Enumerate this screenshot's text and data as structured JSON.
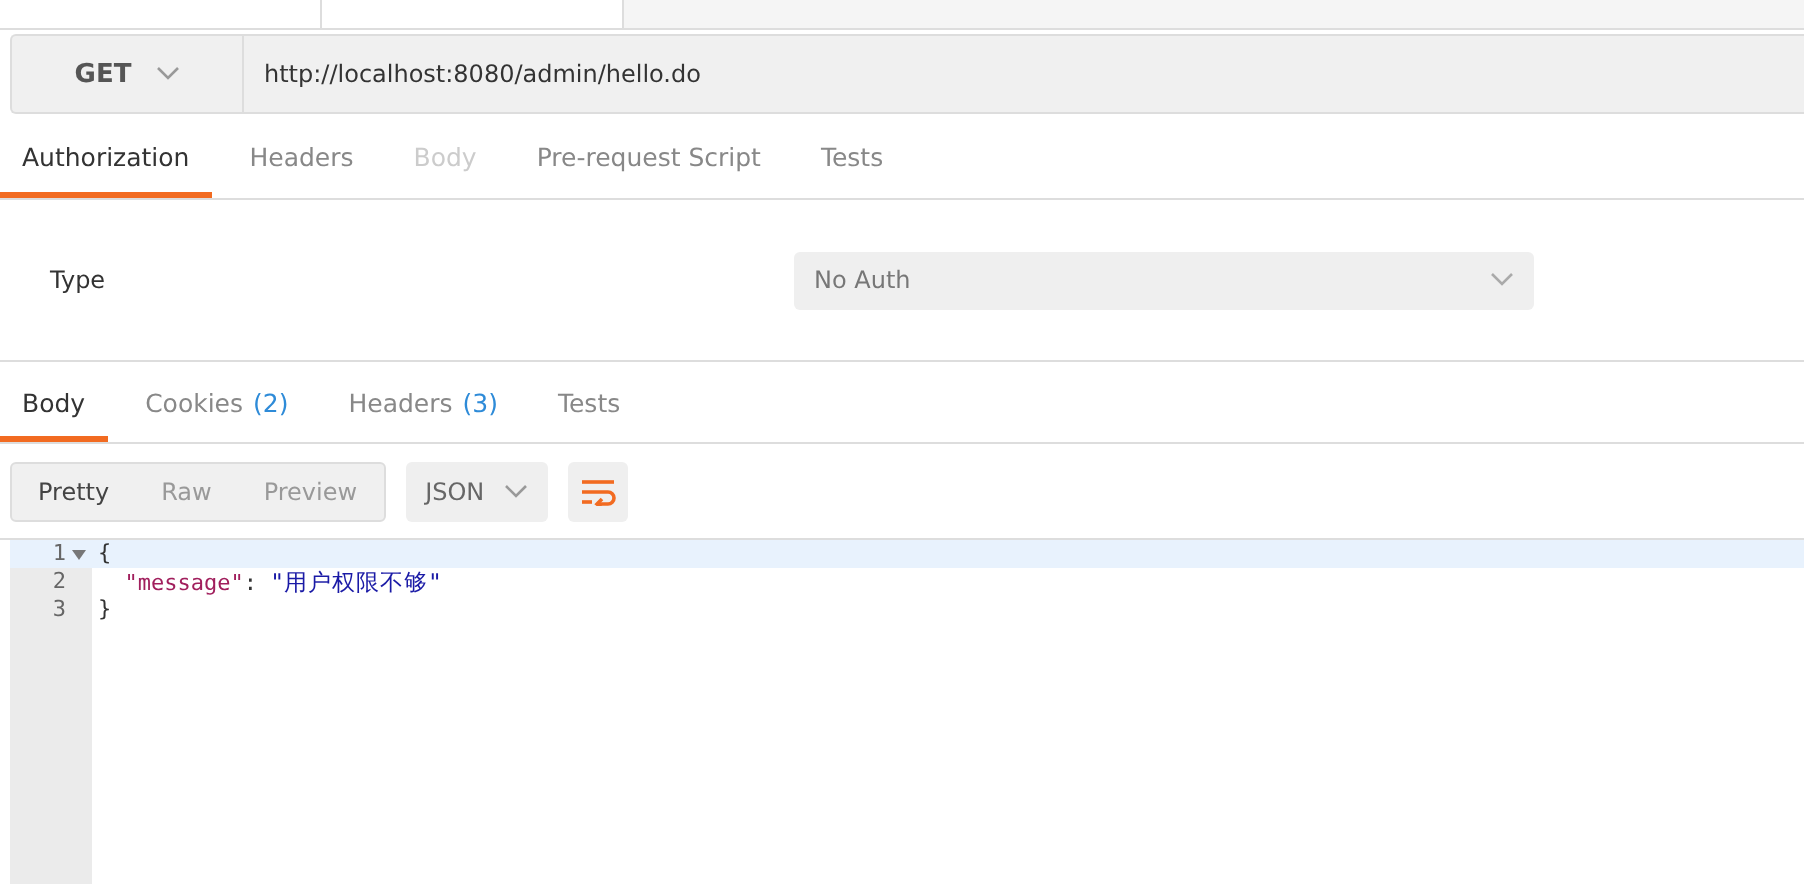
{
  "request": {
    "method": "GET",
    "url": "http://localhost:8080/admin/hello.do"
  },
  "request_tabs": [
    {
      "label": "Authorization",
      "selected": true,
      "disabled": false
    },
    {
      "label": "Headers",
      "selected": false,
      "disabled": false
    },
    {
      "label": "Body",
      "selected": false,
      "disabled": true
    },
    {
      "label": "Pre-request Script",
      "selected": false,
      "disabled": false
    },
    {
      "label": "Tests",
      "selected": false,
      "disabled": false
    }
  ],
  "authorization": {
    "type_label": "Type",
    "type_value": "No Auth"
  },
  "response_tabs": [
    {
      "label": "Body",
      "selected": true
    },
    {
      "label": "Cookies",
      "count": "(2)",
      "selected": false
    },
    {
      "label": "Headers",
      "count": "(3)",
      "selected": false
    },
    {
      "label": "Tests",
      "selected": false
    }
  ],
  "view_modes": [
    {
      "label": "Pretty",
      "selected": true
    },
    {
      "label": "Raw",
      "selected": false
    },
    {
      "label": "Preview",
      "selected": false
    }
  ],
  "format": "JSON",
  "code_lines": [
    {
      "number": "1",
      "kind": "brace",
      "text": "{",
      "foldable": true,
      "active": true
    },
    {
      "number": "2",
      "kind": "pair",
      "key": "\"message\"",
      "sep": ": ",
      "value": "\"用户权限不够\"",
      "foldable": false,
      "active": false
    },
    {
      "number": "3",
      "kind": "brace",
      "text": "}",
      "foldable": false,
      "active": false
    }
  ]
}
